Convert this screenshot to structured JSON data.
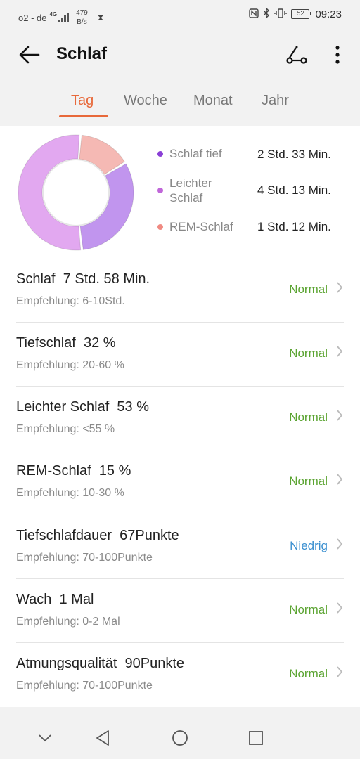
{
  "status_bar": {
    "carrier": "o2 - de",
    "network": "4G",
    "speed_value": "479",
    "speed_unit": "B/s",
    "hourglass_glyph": "⧗",
    "battery": "52",
    "time": "09:23",
    "icons": [
      "nfc-icon",
      "bluetooth-icon",
      "vibrate-icon",
      "battery-icon"
    ]
  },
  "header": {
    "title": "Schlaf",
    "back_icon": "arrow-left-icon",
    "route_icon": "route-icon",
    "more_icon": "more-vertical-icon"
  },
  "tabs": [
    {
      "label": "Tag",
      "active": true
    },
    {
      "label": "Woche",
      "active": false
    },
    {
      "label": "Monat",
      "active": false
    },
    {
      "label": "Jahr",
      "active": false
    }
  ],
  "chart_data": {
    "type": "pie",
    "title": "",
    "series": [
      {
        "name": "Schlaf tief",
        "value_label": "2 Std. 33 Min.",
        "minutes": 153,
        "color": "#c195ee"
      },
      {
        "name": "Leichter Schlaf",
        "value_label": "4 Std. 13 Min.",
        "minutes": 253,
        "color": "#e2a8f0"
      },
      {
        "name": "REM-Schlaf",
        "value_label": "1 Std. 12 Min.",
        "minutes": 72,
        "color": "#f5b9b4"
      }
    ],
    "legend": {
      "items": [
        {
          "label": "Schlaf tief",
          "dot_color": "#8a3fd6",
          "value": "2 Std. 33 Min."
        },
        {
          "label": "Leichter Schlaf",
          "dot_color": "#c067d9",
          "value": "4 Std. 13 Min."
        },
        {
          "label": "REM-Schlaf",
          "dot_color": "#f08a82",
          "value": "1 Std. 12 Min."
        }
      ]
    }
  },
  "metrics": [
    {
      "title": "Schlaf  7 Std. 58 Min.",
      "recommendation": "Empfehlung: 6-10Std.",
      "status": "Normal",
      "status_color": "#5ba432"
    },
    {
      "title": "Tiefschlaf  32 %",
      "recommendation": "Empfehlung: 20-60 %",
      "status": "Normal",
      "status_color": "#5ba432"
    },
    {
      "title": "Leichter Schlaf  53 %",
      "recommendation": "Empfehlung: <55 %",
      "status": "Normal",
      "status_color": "#5ba432"
    },
    {
      "title": "REM-Schlaf  15 %",
      "recommendation": "Empfehlung: 10-30 %",
      "status": "Normal",
      "status_color": "#5ba432"
    },
    {
      "title": "Tiefschlafdauer  67Punkte",
      "recommendation": "Empfehlung: 70-100Punkte",
      "status": "Niedrig",
      "status_color": "#3a8fd0"
    },
    {
      "title": "Wach  1 Mal",
      "recommendation": "Empfehlung: 0-2 Mal",
      "status": "Normal",
      "status_color": "#5ba432"
    },
    {
      "title": "Atmungsqualität  90Punkte",
      "recommendation": "Empfehlung: 70-100Punkte",
      "status": "Normal",
      "status_color": "#5ba432"
    }
  ],
  "nav_bar": {
    "icons": [
      "chevron-down-icon",
      "back-triangle-icon",
      "home-circle-icon",
      "recents-square-icon"
    ]
  },
  "colors": {
    "accent": "#e8693a",
    "normal": "#5ba432",
    "low": "#3a8fd0"
  }
}
